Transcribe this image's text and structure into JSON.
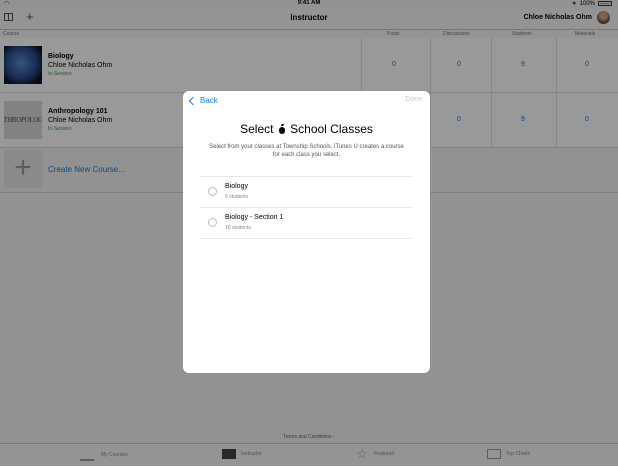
{
  "status_bar": {
    "time": "9:41 AM",
    "battery": "100%"
  },
  "nav": {
    "title": "Instructor",
    "user_name": "Chloe Nicholas Ohm"
  },
  "columns": [
    "Course",
    "Posts",
    "Discussions",
    "Students",
    "Materials"
  ],
  "courses": [
    {
      "name": "Biology",
      "teacher": "Chloe Nicholas Ohm",
      "status": "In-Session",
      "posts": "0",
      "discussions": "0",
      "students": "9",
      "materials": "0"
    },
    {
      "name": "Anthropology 101",
      "teacher": "Chloe Nicholas Ohm",
      "status": "In-Session",
      "thumb_text": "THROPOLOG",
      "posts": "0",
      "discussions": "0",
      "students": "9",
      "materials": "0"
    }
  ],
  "create_label": "Create New Course...",
  "footer": {
    "terms": "Terms and Conditions ›"
  },
  "tabs": [
    {
      "label": "My Courses",
      "icon": "graduation-cap-icon"
    },
    {
      "label": "Instructor",
      "icon": "chalkboard-icon"
    },
    {
      "label": "Featured",
      "icon": "star-icon"
    },
    {
      "label": "Top Charts",
      "icon": "list-icon"
    }
  ],
  "modal": {
    "back_label": "Back",
    "done_label": "Done",
    "title_prefix": "Select",
    "title_suffix": "School Classes",
    "description": "Select from your classes at Township Schools. iTunes U creates a course for each class you select.",
    "classes": [
      {
        "name": "Biology",
        "students": "9 students"
      },
      {
        "name": "Biology - Section 1",
        "students": "16 students"
      }
    ]
  }
}
